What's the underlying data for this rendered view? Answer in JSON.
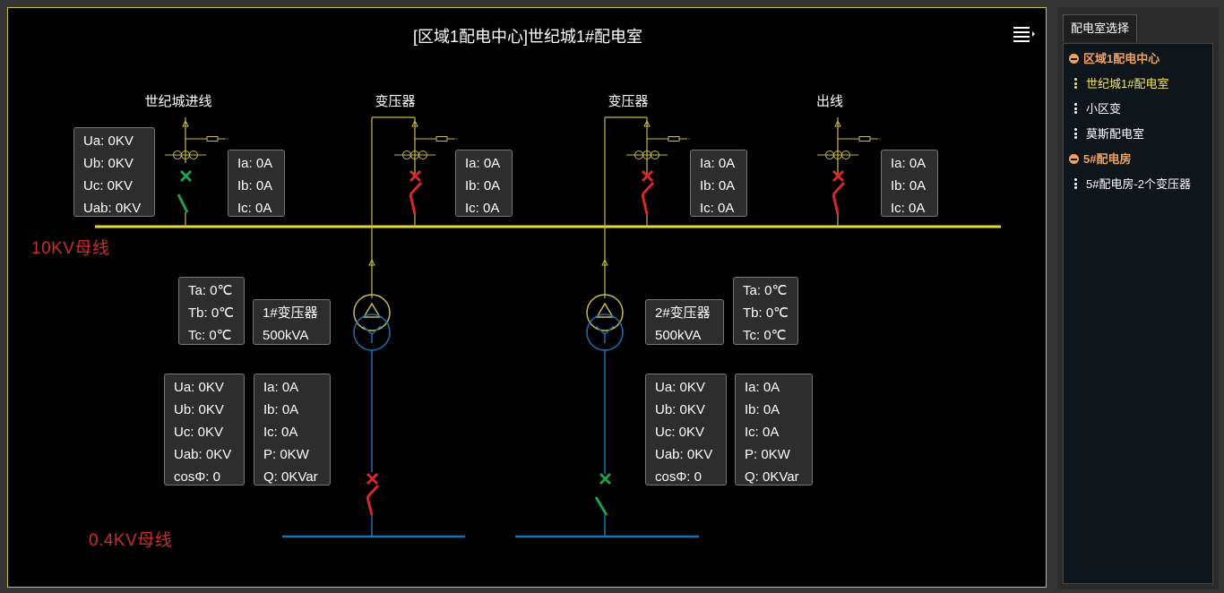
{
  "diagram": {
    "title": "[区域1配电中心]世纪城1#配电室",
    "feeders": [
      {
        "label": "世纪城进线"
      },
      {
        "label": "变压器"
      },
      {
        "label": "变压器"
      },
      {
        "label": "出线"
      }
    ],
    "bus_10kv_label": "10KV母线",
    "bus_04kv_label": "0.4KV母线",
    "incoming_voltage": {
      "ua": "Ua: 0KV",
      "ub": "Ub: 0KV",
      "uc": "Uc: 0KV",
      "uab": "Uab: 0KV"
    },
    "currents": [
      {
        "ia": "Ia: 0A",
        "ib": "Ib: 0A",
        "ic": "Ic: 0A"
      },
      {
        "ia": "Ia: 0A",
        "ib": "Ib: 0A",
        "ic": "Ic: 0A"
      },
      {
        "ia": "Ia: 0A",
        "ib": "Ib: 0A",
        "ic": "Ic: 0A"
      },
      {
        "ia": "Ia: 0A",
        "ib": "Ib: 0A",
        "ic": "Ic: 0A"
      }
    ],
    "transformers": [
      {
        "name": "1#变压器",
        "capacity": "500kVA",
        "temps": {
          "ta": "Ta: 0℃",
          "tb": "Tb: 0℃",
          "tc": "Tc: 0℃"
        },
        "low_voltage": {
          "ua": "Ua: 0KV",
          "ub": "Ub: 0KV",
          "uc": "Uc: 0KV",
          "uab": "Uab: 0KV",
          "cos": "cosΦ: 0"
        },
        "low_current": {
          "ia": "Ia: 0A",
          "ib": "Ib: 0A",
          "ic": "Ic: 0A",
          "p": "P: 0KW",
          "q": "Q: 0KVar"
        }
      },
      {
        "name": "2#变压器",
        "capacity": "500kVA",
        "temps": {
          "ta": "Ta: 0℃",
          "tb": "Tb: 0℃",
          "tc": "Tc: 0℃"
        },
        "low_voltage": {
          "ua": "Ua: 0KV",
          "ub": "Ub: 0KV",
          "uc": "Uc: 0KV",
          "uab": "Uab: 0KV",
          "cos": "cosΦ: 0"
        },
        "low_current": {
          "ia": "Ia: 0A",
          "ib": "Ib: 0A",
          "ic": "Ic: 0A",
          "p": "P: 0KW",
          "q": "Q: 0KVar"
        }
      }
    ],
    "breaker_states": {
      "incoming": "closed",
      "transformer1_high": "open",
      "transformer2_high": "open",
      "outgoing": "open",
      "transformer1_low": "open",
      "transformer2_low": "closed"
    },
    "colors": {
      "bus_10kv": "#e3d73a",
      "bus_04kv": "#1f6fb4",
      "open": "#d8282a",
      "closed": "#1fa04a",
      "frame": "#c9c23a"
    }
  },
  "sidebar": {
    "tab_label": "配电室选择",
    "groups": [
      {
        "label": "区域1配电中心",
        "items": [
          "世纪城1#配电室",
          "小区变",
          "莫斯配电室"
        ]
      },
      {
        "label": "5#配电房",
        "items": [
          "5#配电房-2个变压器"
        ]
      }
    ],
    "selected": "世纪城1#配电室"
  },
  "icons": {
    "menu": "list-menu-icon",
    "group": "minus-circle-icon",
    "item": "vertical-dots-icon"
  }
}
